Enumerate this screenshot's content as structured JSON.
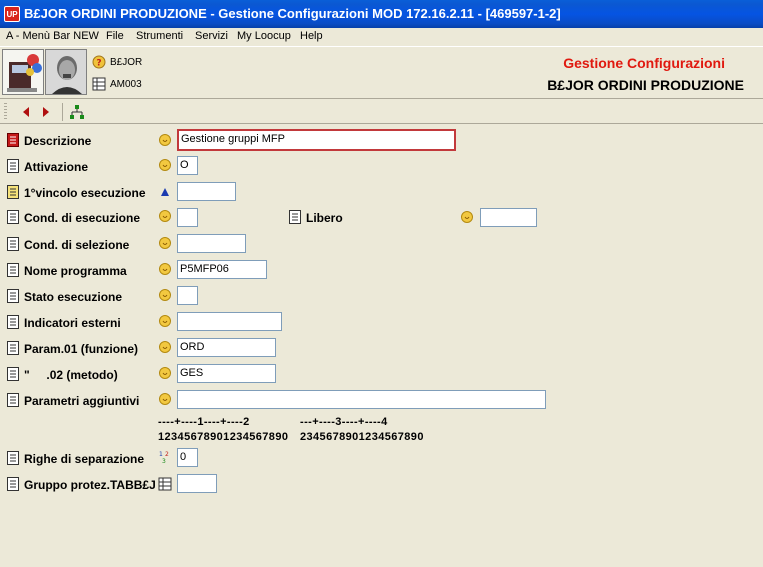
{
  "window": {
    "title": "B£JOR ORDINI PRODUZIONE - Gestione Configurazioni MOD 172.16.2.11 - [469597-1-2]",
    "icon_text": "UP"
  },
  "menu": [
    "A - Menù Bar NEW",
    "File",
    "Strumenti",
    "Servizi",
    "My Loocup",
    "Help"
  ],
  "header": {
    "line1": "B£JOR",
    "line2": "AM003",
    "title": "Gestione Configurazioni",
    "subtitle": "B£JOR ORDINI PRODUZIONE"
  },
  "toolbar": {
    "icons": [
      "arrow-left-icon",
      "arrow-right-icon",
      "tree-icon"
    ]
  },
  "fields": {
    "descrizione": {
      "label": "Descrizione",
      "value": "Gestione gruppi MFP"
    },
    "attivazione": {
      "label": "Attivazione",
      "value": "O"
    },
    "vincolo": {
      "label": "1°vincolo esecuzione",
      "value": ""
    },
    "cond_esecuzione": {
      "label": "Cond. di esecuzione",
      "value": ""
    },
    "libero": {
      "label": "Libero",
      "value": ""
    },
    "cond_selezione": {
      "label": "Cond. di selezione",
      "value": ""
    },
    "nome_programma": {
      "label": "Nome programma",
      "value": "P5MFP06"
    },
    "stato_esecuzione": {
      "label": "Stato esecuzione",
      "value": ""
    },
    "indicatori_esterni": {
      "label": "Indicatori esterni",
      "value": ""
    },
    "param01": {
      "label": "Param.01 (funzione)",
      "value": "ORD"
    },
    "param02": {
      "label": "\"     .02 (metodo)",
      "value": "GES"
    },
    "parametri_aggiuntivi": {
      "label": "Parametri aggiuntivi",
      "value": ""
    },
    "righe_separazione": {
      "label": "Righe di separazione",
      "value": "0"
    },
    "gruppo_protez": {
      "label": "Gruppo protez.TABB£J",
      "value": ""
    }
  },
  "ruler": {
    "top_left": "----+----1----+----2",
    "top_right": "---+----3----+----4",
    "bottom_left": "12345678901234567890",
    "bottom_right": "2345678901234567890"
  },
  "colors": {
    "accent_title": "#e0190f",
    "titlebar": "#0554e3",
    "active_border": "#c2393b"
  }
}
